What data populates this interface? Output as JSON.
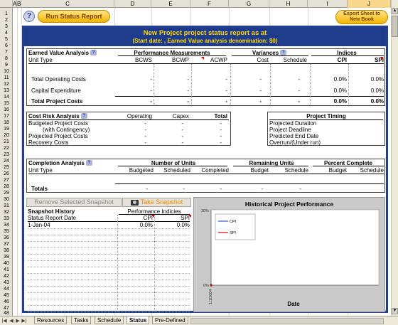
{
  "sheet": {
    "col_headers": [
      "A",
      "B",
      "C",
      "D",
      "E",
      "F",
      "G",
      "H",
      "I",
      "J"
    ],
    "row_numbers": [
      "1",
      "2",
      "3",
      "4",
      "5",
      "6",
      "7",
      "8",
      "9",
      "10",
      "11",
      "12",
      "13",
      "14",
      "15",
      "16",
      "17",
      "18",
      "19",
      "20",
      "21",
      "22",
      "23",
      "24",
      "25",
      "26",
      "27",
      "28",
      "29",
      "30",
      "31",
      "32",
      "33",
      "34",
      "35",
      "36",
      "37",
      "38",
      "39",
      "40",
      "41",
      "42",
      "43",
      "44",
      "45",
      "46",
      "47",
      "48"
    ]
  },
  "toolbar": {
    "help_icon": "?",
    "run_label": "Run Status Report",
    "export_label": "Export Sheet to New Book"
  },
  "banner": {
    "line1": "New Project project status report as at",
    "line2": "(Start date: , Earned Value analysis denomination: $0)"
  },
  "ev": {
    "title": "Earned Value Analysis",
    "unit_type": "Unit Type",
    "perf": "Performance Measurements",
    "variances": "Variances",
    "indices": "Indices",
    "cols": [
      "BCWS",
      "BCWP",
      "ACWP",
      "Cost",
      "Schedule",
      "CPI",
      "SPI"
    ],
    "rows": [
      {
        "label": "Total Operating Costs",
        "vals": [
          "-",
          "-",
          "-",
          "-",
          "-",
          "0.0%",
          "0.0%"
        ]
      },
      {
        "label": "Capital Expenditure",
        "vals": [
          "-",
          "-",
          "-",
          "-",
          "-",
          "0.0%",
          "0.0%"
        ]
      },
      {
        "label": "Total Project Costs",
        "vals": [
          "-",
          "-",
          "-",
          "-",
          "-",
          "0.0%",
          "0.0%"
        ]
      }
    ]
  },
  "risk": {
    "title": "Cost Risk Analysis",
    "cols": [
      "Operating",
      "Capex",
      "Total"
    ],
    "rows": [
      {
        "label": "Budgeted Project Costs",
        "vals": [
          "-",
          "-",
          "-"
        ]
      },
      {
        "label": "(with Contingency)",
        "vals": [
          "-",
          "-",
          "-"
        ]
      },
      {
        "label": "Projected Project Costs",
        "vals": [
          "-",
          "-",
          "-"
        ]
      },
      {
        "label": "Recovery Costs",
        "vals": [
          "-",
          "-",
          "-"
        ]
      }
    ]
  },
  "timing": {
    "title": "Project Timing",
    "rows": [
      "Projected Duration",
      "Project Deadline",
      "Predicted End Date",
      "Overrun/(Under run)"
    ]
  },
  "completion": {
    "title": "Completion Analysis",
    "unit_type": "Unit Type",
    "units": "Number of Units",
    "remaining": "Remaining Units",
    "percent": "Percent Complete",
    "cols": [
      "Budgeted",
      "Scheduled",
      "Completed",
      "Budget",
      "Schedule",
      "Budget",
      "Schedule"
    ],
    "totals_label": "Totals",
    "totals": [
      "-",
      "-",
      "-",
      "-",
      "-",
      "",
      ""
    ]
  },
  "snapshot": {
    "remove_label": "Remove Selected Snapshot",
    "take_label": "Take Snapshot",
    "history_title": "Snapshot History",
    "perf_title": "Performance Indicies",
    "date_col": "Status Report Date",
    "cpi": "CPI",
    "spi": "SPI",
    "rows": [
      {
        "date": "1-Jan-04",
        "cpi": "0.0%",
        "spi": "0.0%"
      }
    ]
  },
  "chart_data": {
    "type": "line",
    "title": "Historical Project Performance",
    "xlabel": "Date",
    "ylabel": "",
    "x": [
      "1/1/2004"
    ],
    "series": [
      {
        "name": "CPI",
        "values": [
          0
        ],
        "color": "#3355cc"
      },
      {
        "name": "SPI",
        "values": [
          0
        ],
        "color": "#dd0000"
      }
    ],
    "ylim": [
      0,
      20
    ],
    "yticks": [
      "20%",
      "0%"
    ],
    "legend": "top-left"
  },
  "tabs": [
    "Resources",
    "Tasks",
    "Schedule",
    "Status",
    "Pre-Defined"
  ],
  "active_tab": "Status"
}
